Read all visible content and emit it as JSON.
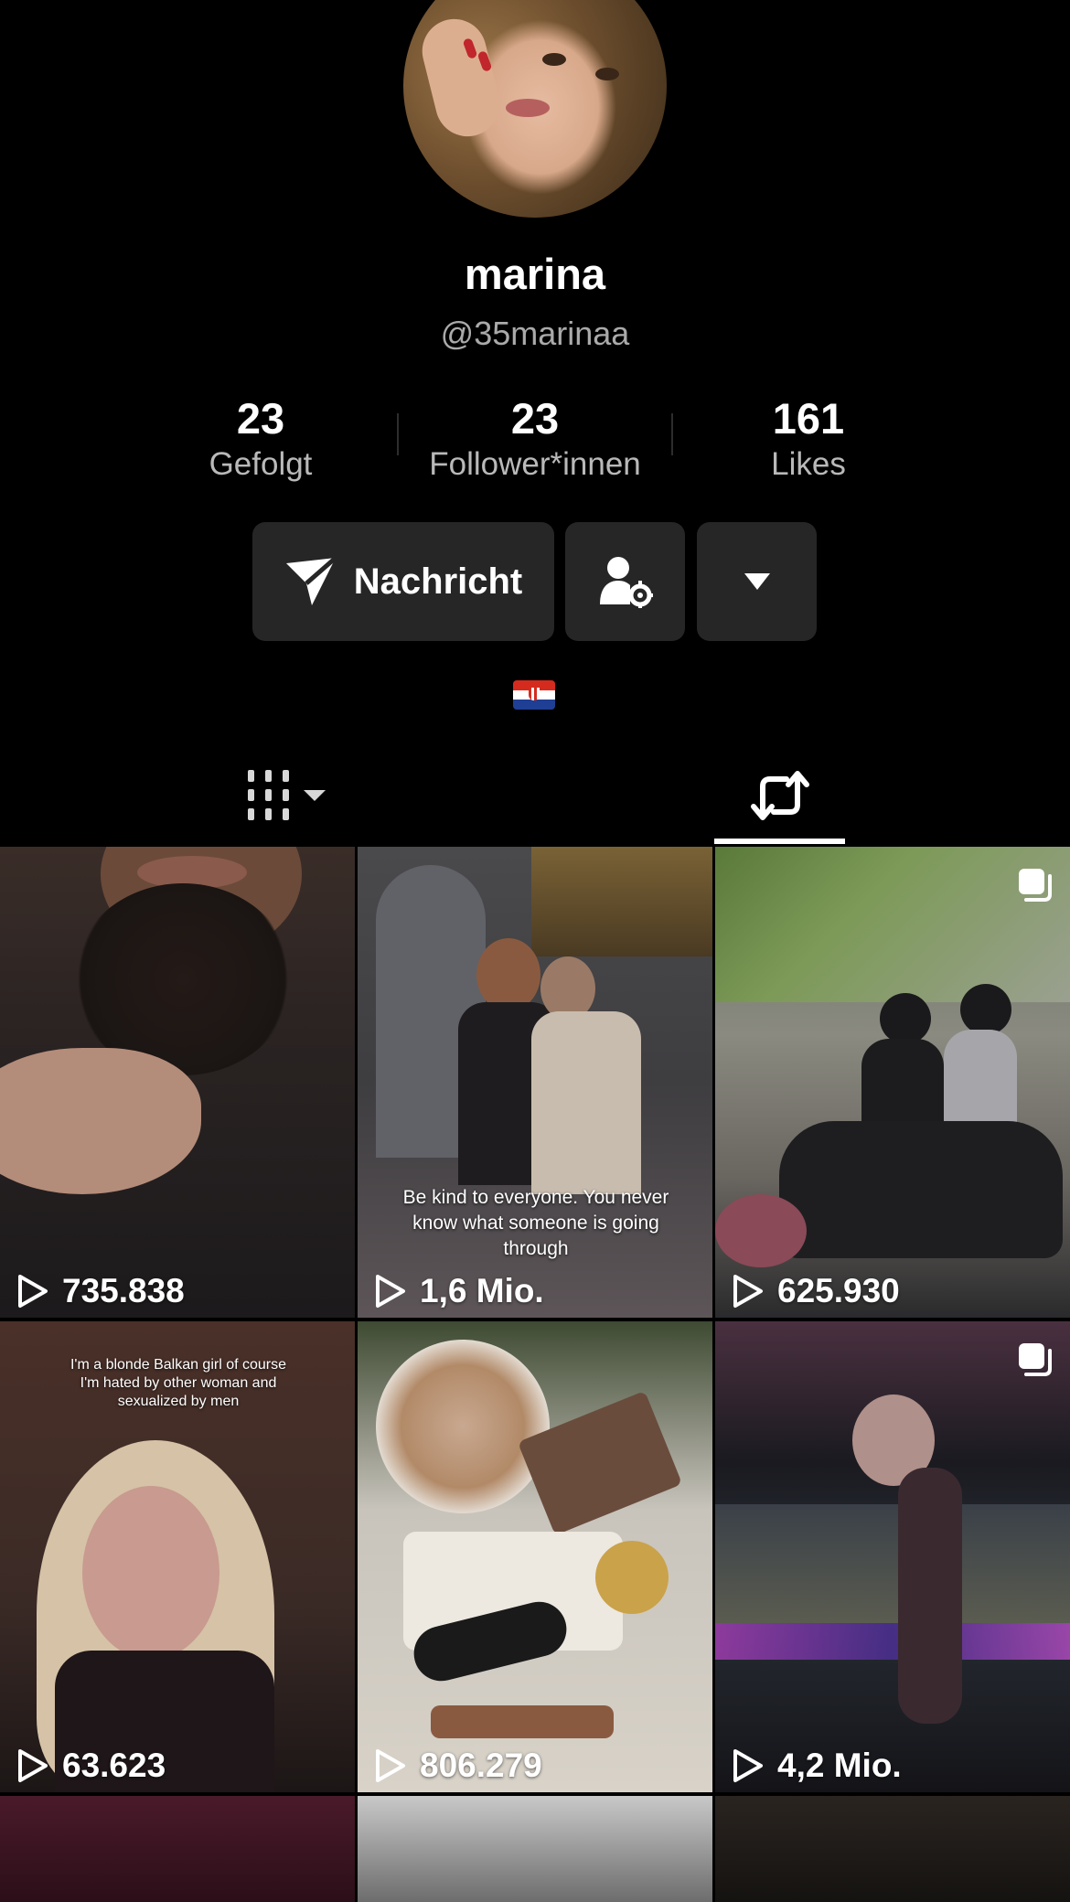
{
  "profile": {
    "display_name": "marina",
    "handle": "@35marinaa",
    "stats": [
      {
        "value": "23",
        "label": "Gefolgt"
      },
      {
        "value": "23",
        "label": "Follower*innen"
      },
      {
        "value": "161",
        "label": "Likes"
      }
    ],
    "message_button_label": "Nachricht",
    "bio_flag": "Croatia flag"
  },
  "tabs": [
    {
      "name": "videos-grid",
      "icon": "grid-bars-icon",
      "active": false
    },
    {
      "name": "reposts",
      "icon": "repost-icon",
      "active": true
    }
  ],
  "videos": [
    {
      "views": "735.838",
      "caption": "",
      "multi_image": false
    },
    {
      "views": "1,6 Mio.",
      "caption": "Be kind to everyone. You never know what someone is going through",
      "multi_image": false
    },
    {
      "views": "625.930",
      "caption": "",
      "multi_image": true
    },
    {
      "views": "63.623",
      "caption": "I'm a blonde Balkan girl  of course I'm hated by other woman and sexualized by men",
      "multi_image": false
    },
    {
      "views": "806.279",
      "caption": "",
      "multi_image": false
    },
    {
      "views": "4,2 Mio.",
      "caption": "",
      "multi_image": true
    }
  ],
  "colors": {
    "background": "#000000",
    "button_bg": "#262626",
    "secondary_text": "#aaaaaa"
  }
}
